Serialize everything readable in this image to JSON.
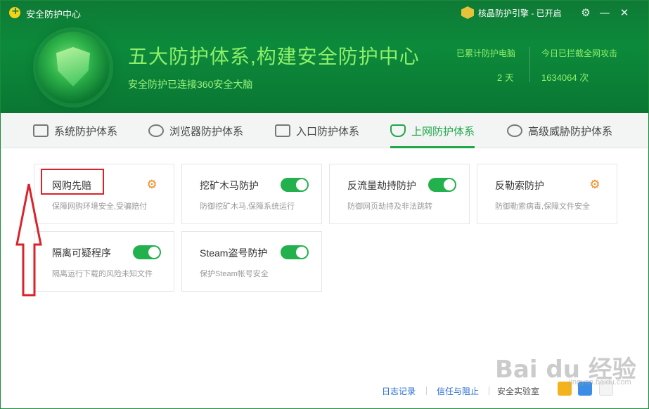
{
  "window": {
    "title": "安全防护中心",
    "engine_status": "核晶防护引擎 - 已开启",
    "settings_icon": "gear-icon",
    "minimize_icon": "minimize-icon",
    "close_icon": "close-icon"
  },
  "hero": {
    "headline": "五大防护体系,构建安全防护中心",
    "subline": "安全防护已连接360安全大脑",
    "stats": [
      {
        "label": "已累计防护电脑",
        "value": "2 天"
      },
      {
        "label": "今日已拦截全网攻击",
        "value": "1634064 次"
      }
    ]
  },
  "tabs": [
    {
      "label": "系统防护体系",
      "icon": "monitor-icon"
    },
    {
      "label": "浏览器防护体系",
      "icon": "browser-icon"
    },
    {
      "label": "入口防护体系",
      "icon": "server-icon"
    },
    {
      "label": "上网防护体系",
      "icon": "shield-pulse-icon",
      "active": true
    },
    {
      "label": "高级威胁防护体系",
      "icon": "target-icon"
    }
  ],
  "cards": [
    {
      "title": "网购先赔",
      "desc": "保障网购环境安全,受骗赔付",
      "control": "gear"
    },
    {
      "title": "挖矿木马防护",
      "desc": "防御挖矿木马,保障系统运行",
      "control": "toggle",
      "enabled": true
    },
    {
      "title": "反流量劫持防护",
      "desc": "防御网页劫持及非法跳转",
      "control": "toggle",
      "enabled": true
    },
    {
      "title": "反勒索防护",
      "desc": "防御勒索病毒,保障文件安全",
      "control": "gear"
    },
    {
      "title": "隔离可疑程序",
      "desc": "隔离运行下载的风险未知文件",
      "control": "toggle",
      "enabled": true
    },
    {
      "title": "Steam盗号防护",
      "desc": "保护Steam帐号安全",
      "control": "toggle",
      "enabled": true
    }
  ],
  "footer": {
    "log_link": "日志记录",
    "trust_link": "信任与阻止",
    "lab_label": "安全实验室"
  },
  "watermark": {
    "text": "Bai du 经验",
    "sub": "jingyan.baidu.com"
  },
  "colors": {
    "brand_green": "#0c8a3b",
    "accent_green": "#1fa64a",
    "highlight_red": "#d9232b",
    "gear_orange": "#f08a1e"
  }
}
